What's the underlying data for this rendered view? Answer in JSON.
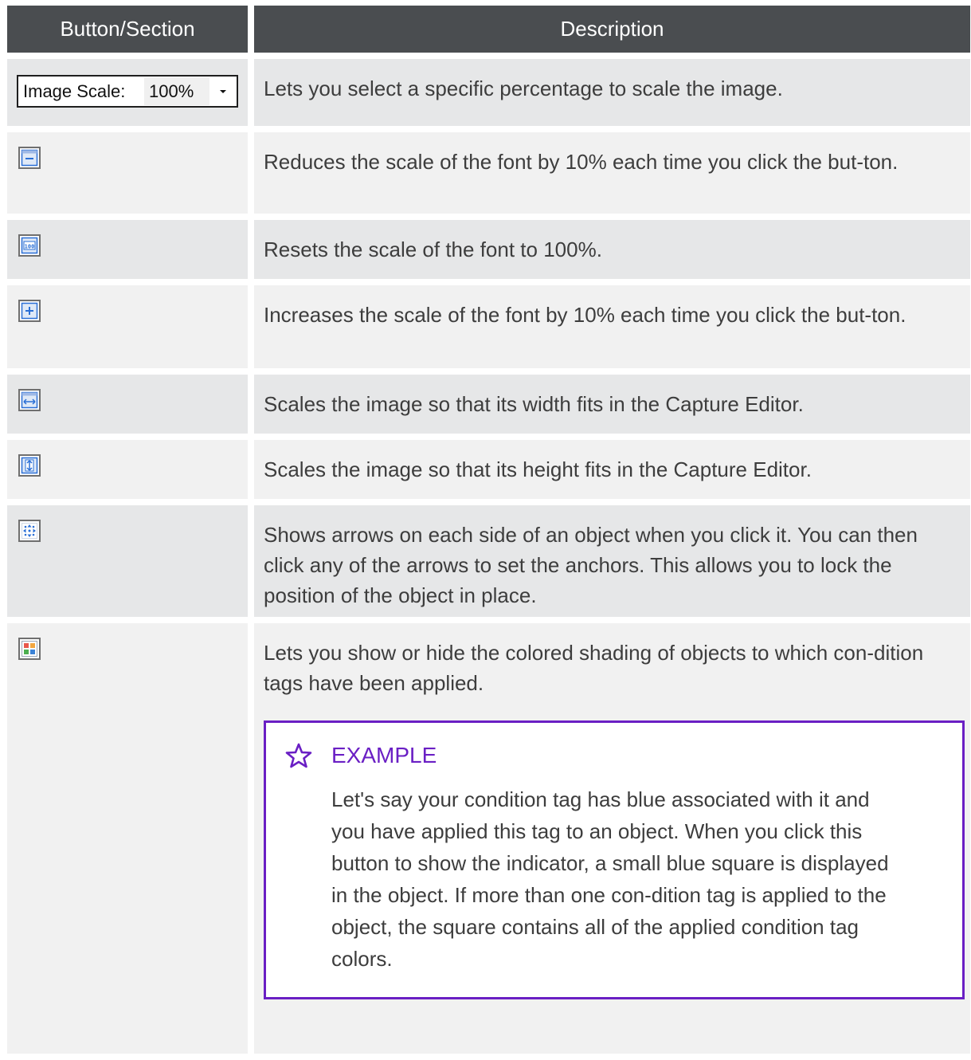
{
  "header": {
    "col1": "Button/Section",
    "col2": "Description"
  },
  "image_scale": {
    "label": "Image Scale:",
    "value": "100%"
  },
  "rows": [
    {
      "icon": "image-scale-dropdown",
      "description": "Lets you select a specific percentage to scale the image."
    },
    {
      "icon": "zoom-out-icon",
      "description": "Reduces the scale of the font by 10% each time you click the but-ton."
    },
    {
      "icon": "reset-100-icon",
      "description": "Resets the scale of the font to 100%."
    },
    {
      "icon": "zoom-in-icon",
      "description": "Increases the scale of the font by 10% each time you click the but-ton."
    },
    {
      "icon": "fit-width-icon",
      "description": "Scales the image so that its width fits in the Capture Editor."
    },
    {
      "icon": "fit-height-icon",
      "description": "Scales the image so that its height fits in the Capture Editor."
    },
    {
      "icon": "anchors-icon",
      "description": "Shows arrows on each side of an object when you click it. You can then click any of the arrows to set the anchors. This allows you to lock the position of the object in place."
    },
    {
      "icon": "condition-tags-icon",
      "description": "Lets you show or hide the colored shading of objects to which con-dition tags have been applied."
    }
  ],
  "example": {
    "title": "EXAMPLE",
    "text": "Let's say your condition tag has blue associated with it and you have applied this tag to an object. When you click this button to show the indicator, a small blue square is displayed in the object. If more than one con-dition tag is applied to the object, the square contains all of the applied condition tag colors."
  },
  "colors": {
    "header_bg": "#4a4d50",
    "example_accent": "#6a1fc4",
    "icon_blue": "#2a6fd6"
  }
}
